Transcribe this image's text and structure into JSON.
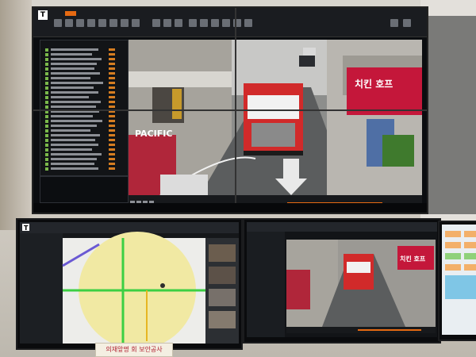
{
  "scene": {
    "background_color": "#cfcac1",
    "accent_color": "#e66a12"
  },
  "video_wall": {
    "app_logo_letter": "T",
    "menu_icons": [
      "camera-icon",
      "layout-icon",
      "grid-icon",
      "record-icon",
      "search-icon",
      "map-icon",
      "settings-icon",
      "export-icon"
    ],
    "street_sign_left": "PACIFIC",
    "shop_sign_korean": "치킨 호프"
  },
  "bottom_left_monitor": {
    "app_logo_letter": "T",
    "map_colors": {
      "zone": "#f1e9a3",
      "road_green": "#3ccf43",
      "road_purple": "#6a59d3"
    }
  },
  "bottom_right_monitor": {
    "shop_sign_korean": "치킨 호프"
  },
  "desk_sign": {
    "text": "의재앞명 회 보안공사"
  }
}
